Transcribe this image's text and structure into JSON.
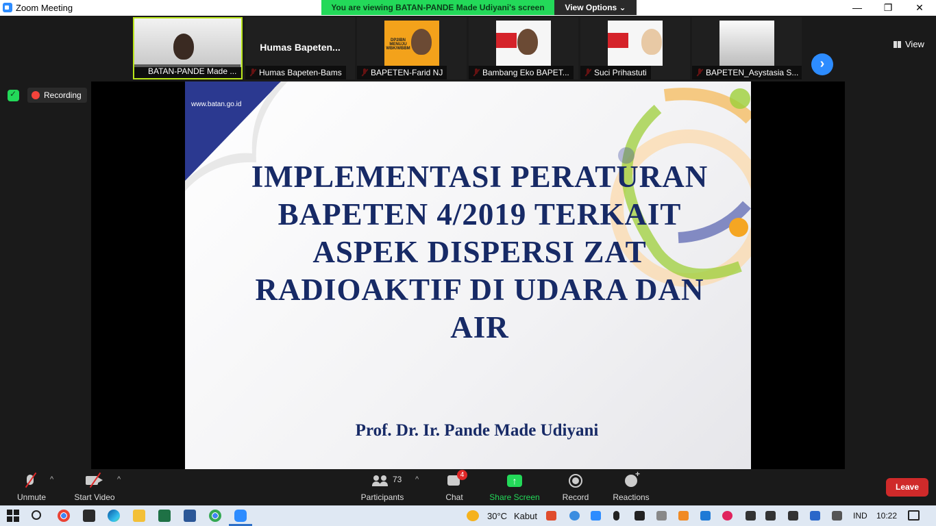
{
  "window": {
    "title": "Zoom Meeting",
    "minimize_glyph": "—",
    "maximize_glyph": "❐",
    "close_glyph": "✕"
  },
  "share_banner": {
    "viewing_text": "You are viewing BATAN-PANDE Made Udiyani's screen",
    "view_options_label": "View Options ⌄"
  },
  "gallery": {
    "tiles": [
      {
        "name": "BATAN-PANDE Made ...",
        "active": true,
        "mic": "active-speaker"
      },
      {
        "name": "Humas Bapeten-Bams",
        "display_name": "Humas  Bapeten...",
        "mic": "muted"
      },
      {
        "name": "BAPETEN-Farid NJ",
        "thumb_text": "DP2IBN MENUJU WBK/WBBM",
        "mic": "muted"
      },
      {
        "name": "Bambang Eko BAPET...",
        "mic": "muted"
      },
      {
        "name": "Suci Prihastuti",
        "mic": "muted"
      },
      {
        "name": "BAPETEN_Asystasia S...",
        "mic": "muted"
      }
    ],
    "next_page_glyph": "›",
    "view_label": "View"
  },
  "status": {
    "recording_label": "Recording",
    "encryption_icon": "shield-check-icon"
  },
  "slide": {
    "url": "www.batan.go.id",
    "title": "IMPLEMENTASI PERATURAN BAPETEN 4/2019 TERKAIT ASPEK DISPERSI ZAT RADIOAKTIF DI UDARA DAN AIR",
    "author": "Prof. Dr. Ir. Pande Made Udiyani"
  },
  "toolbar": {
    "unmute_label": "Unmute",
    "start_video_label": "Start Video",
    "participants_label": "Participants",
    "participants_count": "73",
    "chat_label": "Chat",
    "chat_badge": "4",
    "share_screen_label": "Share Screen",
    "share_glyph": "↑",
    "record_label": "Record",
    "reactions_label": "Reactions",
    "leave_label": "Leave",
    "caret_glyph": "^"
  },
  "taskbar": {
    "weather_temp": "30°C",
    "weather_condition": "Kabut",
    "language": "IND",
    "time": "10:22"
  },
  "colors": {
    "zoom_blue": "#2d8cff",
    "share_green": "#23d959",
    "leave_red": "#cf2a2a",
    "slide_navy": "#172a66"
  }
}
